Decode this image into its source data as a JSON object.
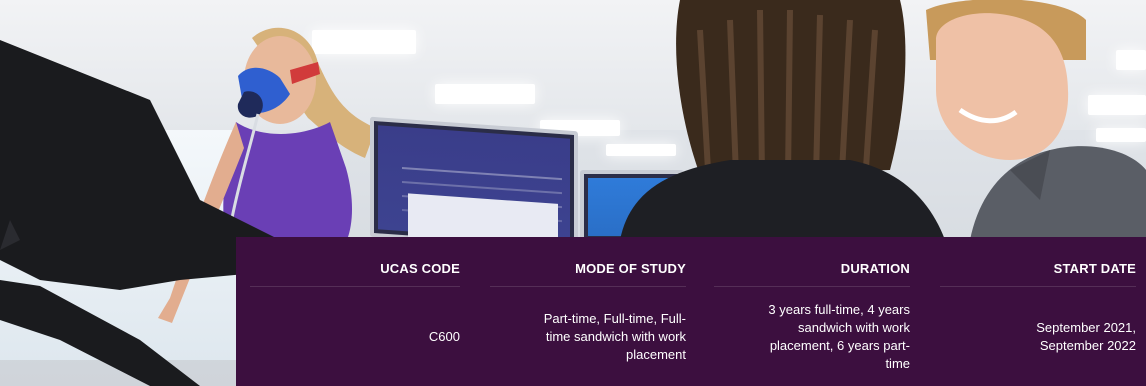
{
  "hero": {
    "image_description_icon": "photo-exercise-lab"
  },
  "course_info": {
    "columns": [
      {
        "heading": "UCAS CODE",
        "value": "C600"
      },
      {
        "heading": "MODE OF STUDY",
        "value_lines": [
          "Part-time, Full-time, Full-",
          "time sandwich with work",
          "placement"
        ]
      },
      {
        "heading": "DURATION",
        "value_lines": [
          "3 years full-time, 4 years",
          "sandwich with work",
          "placement, 6 years part-",
          "time"
        ]
      },
      {
        "heading": "START DATE",
        "value_lines": [
          "September 2021,",
          "September 2022"
        ]
      }
    ]
  },
  "colors": {
    "info_bar_bg": "#3c0f3f",
    "info_text": "#ffffff"
  }
}
